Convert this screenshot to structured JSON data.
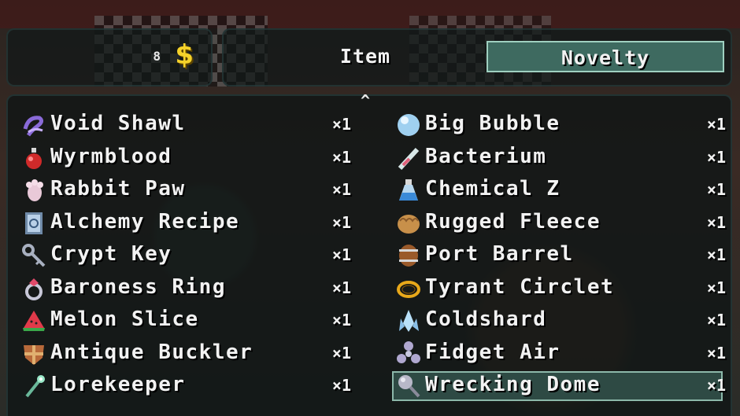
{
  "header": {
    "money_amount": "8",
    "money_symbol": "$",
    "tabs": [
      {
        "label": "Item",
        "active": false
      },
      {
        "label": "Novelty",
        "active": true
      }
    ],
    "scroll_up": "^"
  },
  "items_left": [
    {
      "name": "Void Shawl",
      "qty": "×1",
      "icon": "void-shawl-icon"
    },
    {
      "name": "Wyrmblood",
      "qty": "×1",
      "icon": "wyrmblood-icon"
    },
    {
      "name": "Rabbit Paw",
      "qty": "×1",
      "icon": "rabbit-paw-icon"
    },
    {
      "name": "Alchemy Recipe",
      "qty": "×1",
      "icon": "alchemy-recipe-icon"
    },
    {
      "name": "Crypt Key",
      "qty": "×1",
      "icon": "crypt-key-icon"
    },
    {
      "name": "Baroness Ring",
      "qty": "×1",
      "icon": "baroness-ring-icon"
    },
    {
      "name": "Melon Slice",
      "qty": "×1",
      "icon": "melon-slice-icon"
    },
    {
      "name": "Antique Buckler",
      "qty": "×1",
      "icon": "antique-buckler-icon"
    },
    {
      "name": "Lorekeeper",
      "qty": "×1",
      "icon": "lorekeeper-icon"
    }
  ],
  "items_right": [
    {
      "name": "Big Bubble",
      "qty": "×1",
      "icon": "big-bubble-icon"
    },
    {
      "name": "Bacterium",
      "qty": "×1",
      "icon": "bacterium-icon"
    },
    {
      "name": "Chemical Z",
      "qty": "×1",
      "icon": "chemical-z-icon"
    },
    {
      "name": "Rugged Fleece",
      "qty": "×1",
      "icon": "rugged-fleece-icon"
    },
    {
      "name": "Port Barrel",
      "qty": "×1",
      "icon": "port-barrel-icon"
    },
    {
      "name": "Tyrant Circlet",
      "qty": "×1",
      "icon": "tyrant-circlet-icon"
    },
    {
      "name": "Coldshard",
      "qty": "×1",
      "icon": "coldshard-icon"
    },
    {
      "name": "Fidget Air",
      "qty": "×1",
      "icon": "fidget-air-icon"
    },
    {
      "name": "Wrecking Dome",
      "qty": "×1",
      "icon": "wrecking-dome-icon",
      "selected": true
    }
  ],
  "colors": {
    "accent_tab": "#3e6a60",
    "money": "#f5d22a",
    "selection": "#2e4a44"
  }
}
